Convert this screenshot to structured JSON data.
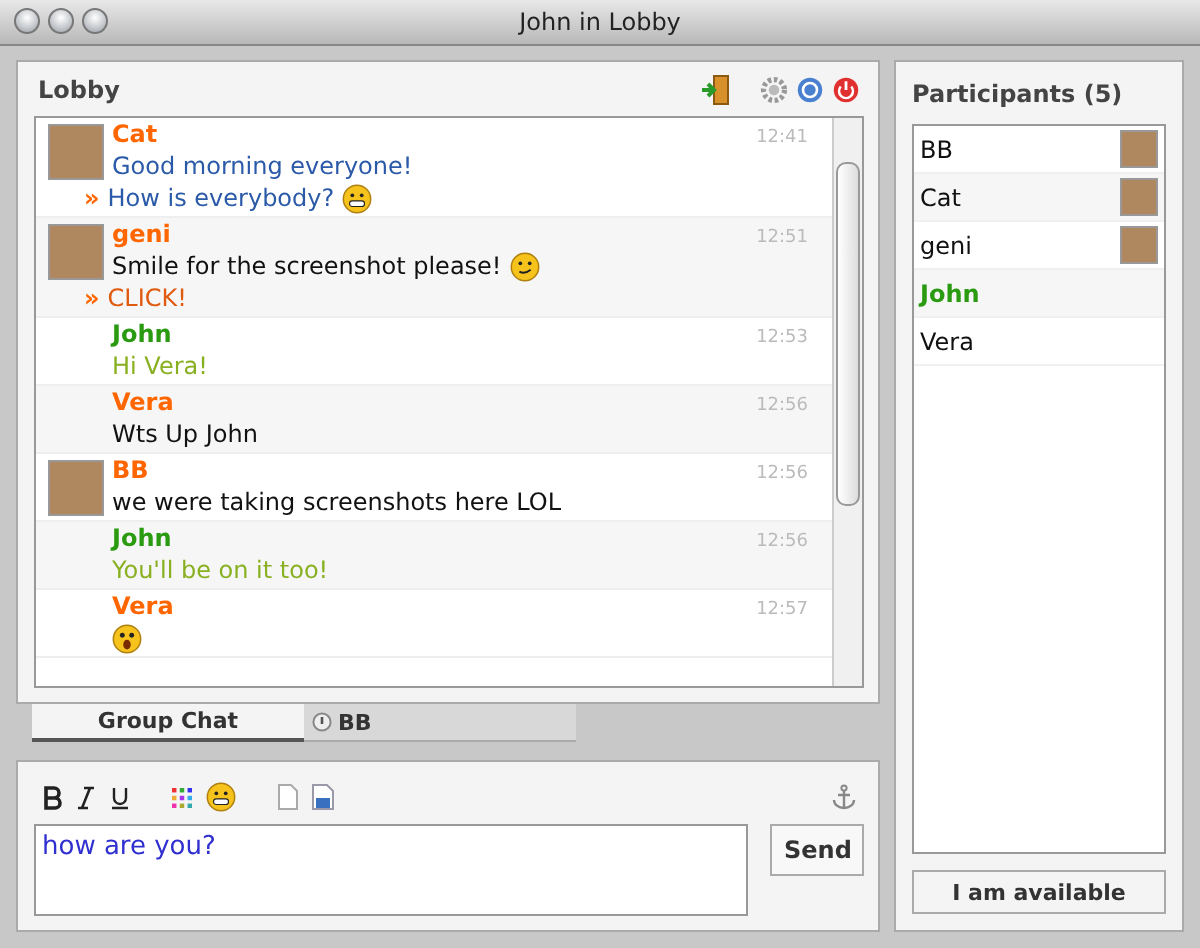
{
  "window": {
    "title": "John in Lobby"
  },
  "room": {
    "title": "Lobby"
  },
  "messages": [
    {
      "author": "Cat",
      "self": false,
      "time": "12:41",
      "avatar": true,
      "lines": [
        {
          "kind": "plain",
          "text": "Good morning everyone!",
          "color": "#2a5aa8"
        },
        {
          "kind": "grin",
          "marker": "»",
          "text": "How is everybody?",
          "color": "#2a5aa8"
        }
      ]
    },
    {
      "author": "geni",
      "self": false,
      "time": "12:51",
      "avatar": true,
      "lines": [
        {
          "kind": "smirk",
          "text": "Smile for the screenshot please!",
          "color": "#111111"
        },
        {
          "kind": "plain",
          "marker": "»",
          "text": "CLICK!",
          "color": "#e05a10"
        }
      ]
    },
    {
      "author": "John",
      "self": true,
      "time": "12:53",
      "avatar": false,
      "lines": [
        {
          "kind": "plain",
          "text": "Hi Vera!",
          "color": "#88b020"
        }
      ]
    },
    {
      "author": "Vera",
      "self": false,
      "time": "12:56",
      "avatar": false,
      "lines": [
        {
          "kind": "plain",
          "text": "Wts Up John",
          "color": "#111111"
        }
      ]
    },
    {
      "author": "BB",
      "self": false,
      "time": "12:56",
      "avatar": true,
      "lines": [
        {
          "kind": "plain",
          "text": "we were taking screenshots here LOL",
          "color": "#111111"
        }
      ]
    },
    {
      "author": "John",
      "self": true,
      "time": "12:56",
      "avatar": false,
      "lines": [
        {
          "kind": "plain",
          "text": "You'll be on it too!",
          "color": "#88b020"
        }
      ]
    },
    {
      "author": "Vera",
      "self": false,
      "time": "12:57",
      "avatar": false,
      "lines": [
        {
          "kind": "shock"
        }
      ]
    }
  ],
  "tabs": [
    {
      "label": "Group Chat",
      "selected": true,
      "alert": false
    },
    {
      "label": "BB",
      "selected": false,
      "alert": true
    }
  ],
  "compose": {
    "value": "how are you?",
    "send": "Send"
  },
  "participants": {
    "title": "Participants (5)",
    "items": [
      {
        "name": "BB",
        "self": false,
        "avatar": true
      },
      {
        "name": "Cat",
        "self": false,
        "avatar": true
      },
      {
        "name": "geni",
        "self": false,
        "avatar": true
      },
      {
        "name": "John",
        "self": true,
        "avatar": false
      },
      {
        "name": "Vera",
        "self": false,
        "avatar": false
      }
    ]
  },
  "status_button": "I am available"
}
